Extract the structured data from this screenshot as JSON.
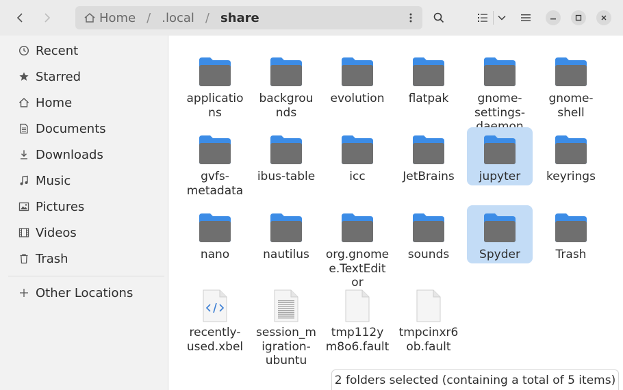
{
  "header": {
    "path": [
      "Home",
      ".local",
      "share"
    ],
    "separator": "/"
  },
  "sidebar": {
    "items": [
      {
        "label": "Recent",
        "icon": "clock-icon"
      },
      {
        "label": "Starred",
        "icon": "star-icon"
      },
      {
        "label": "Home",
        "icon": "home-icon"
      },
      {
        "label": "Documents",
        "icon": "document-icon"
      },
      {
        "label": "Downloads",
        "icon": "download-icon"
      },
      {
        "label": "Music",
        "icon": "music-icon"
      },
      {
        "label": "Pictures",
        "icon": "picture-icon"
      },
      {
        "label": "Videos",
        "icon": "video-icon"
      },
      {
        "label": "Trash",
        "icon": "trash-icon"
      }
    ],
    "other_locations": {
      "label": "Other Locations",
      "icon": "plus-icon"
    }
  },
  "files": [
    {
      "name": "applications",
      "lines": [
        "applicatio",
        "ns"
      ],
      "type": "folder",
      "selected": false
    },
    {
      "name": "backgrounds",
      "lines": [
        "backgrou",
        "nds"
      ],
      "type": "folder",
      "selected": false
    },
    {
      "name": "evolution",
      "lines": [
        "evolution"
      ],
      "type": "folder",
      "selected": false
    },
    {
      "name": "flatpak",
      "lines": [
        "flatpak"
      ],
      "type": "folder",
      "selected": false
    },
    {
      "name": "gnome-settings-daemon",
      "lines": [
        "gnome-",
        "settings-",
        "daemon"
      ],
      "type": "folder",
      "selected": false
    },
    {
      "name": "gnome-shell",
      "lines": [
        "gnome-",
        "shell"
      ],
      "type": "folder",
      "selected": false
    },
    {
      "name": "gvfs-metadata",
      "lines": [
        "gvfs-",
        "metadata"
      ],
      "type": "folder",
      "selected": false
    },
    {
      "name": "ibus-table",
      "lines": [
        "ibus-table"
      ],
      "type": "folder",
      "selected": false
    },
    {
      "name": "icc",
      "lines": [
        "icc"
      ],
      "type": "folder",
      "selected": false
    },
    {
      "name": "JetBrains",
      "lines": [
        "JetBrains"
      ],
      "type": "folder",
      "selected": false
    },
    {
      "name": "jupyter",
      "lines": [
        "jupyter"
      ],
      "type": "folder",
      "selected": true
    },
    {
      "name": "keyrings",
      "lines": [
        "keyrings"
      ],
      "type": "folder",
      "selected": false
    },
    {
      "name": "nano",
      "lines": [
        "nano"
      ],
      "type": "folder",
      "selected": false
    },
    {
      "name": "nautilus",
      "lines": [
        "nautilus"
      ],
      "type": "folder",
      "selected": false
    },
    {
      "name": "org.gnome.TextEditor",
      "lines": [
        "org.gnome",
        "e.TextEdit",
        "or"
      ],
      "type": "folder",
      "selected": false
    },
    {
      "name": "sounds",
      "lines": [
        "sounds"
      ],
      "type": "folder",
      "selected": false
    },
    {
      "name": "Spyder",
      "lines": [
        "Spyder"
      ],
      "type": "folder",
      "selected": true
    },
    {
      "name": "Trash",
      "lines": [
        "Trash"
      ],
      "type": "folder",
      "selected": false
    },
    {
      "name": "recently-used.xbel",
      "lines": [
        "recently-",
        "used.xbel"
      ],
      "type": "xml",
      "selected": false
    },
    {
      "name": "session_migration-ubuntu",
      "lines": [
        "session_m",
        "igration-",
        "ubuntu"
      ],
      "type": "text",
      "selected": false
    },
    {
      "name": "tmp112ym8o6.fault",
      "lines": [
        "tmp112y",
        "m8o6.fault"
      ],
      "type": "blank",
      "selected": false
    },
    {
      "name": "tmpcinxr6ob.fault",
      "lines": [
        "tmpcinxr6",
        "ob.fault"
      ],
      "type": "blank",
      "selected": false
    }
  ],
  "status": {
    "text": "2 folders selected  (containing a total of 5 items)"
  },
  "colors": {
    "folder_tab": "#3c8ce6",
    "folder_body": "#6f6f6f",
    "selection": "#c3dcf6"
  }
}
